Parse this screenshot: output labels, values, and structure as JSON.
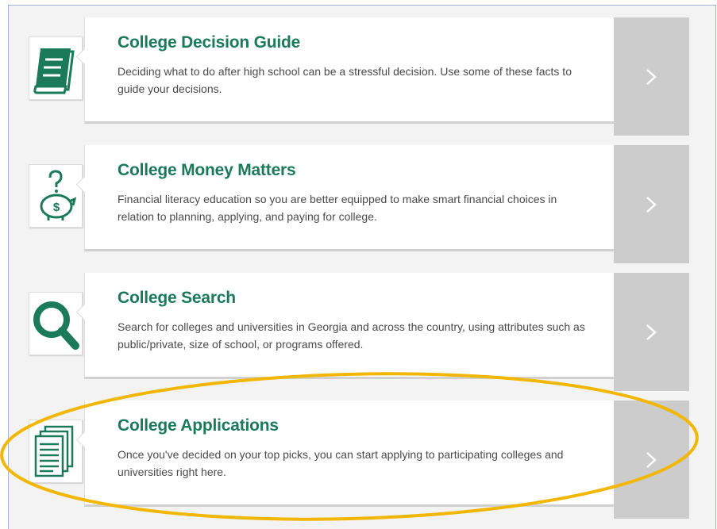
{
  "cards": [
    {
      "title": "College Decision Guide",
      "description": "Deciding what to do after high school can be a stressful decision. Use some of these facts to guide your decisions.",
      "icon": "book-icon"
    },
    {
      "title": "College Money Matters",
      "description": "Financial literacy education so you are better equipped to make smart financial choices in relation to planning, applying, and paying for college.",
      "icon": "piggy-bank-icon"
    },
    {
      "title": "College Search",
      "description": "Search for colleges and universities in Georgia and across the country, using attributes such as public/private, size of school, or programs offered.",
      "icon": "magnifier-icon"
    },
    {
      "title": "College Applications",
      "description": "Once you've decided on your top picks, you can start applying to participating colleges and universities right here.",
      "icon": "documents-icon"
    }
  ],
  "colors": {
    "accent_green": "#1a7a5a",
    "arrow_bg": "#cccccc",
    "highlight_ellipse": "#f2b705"
  }
}
